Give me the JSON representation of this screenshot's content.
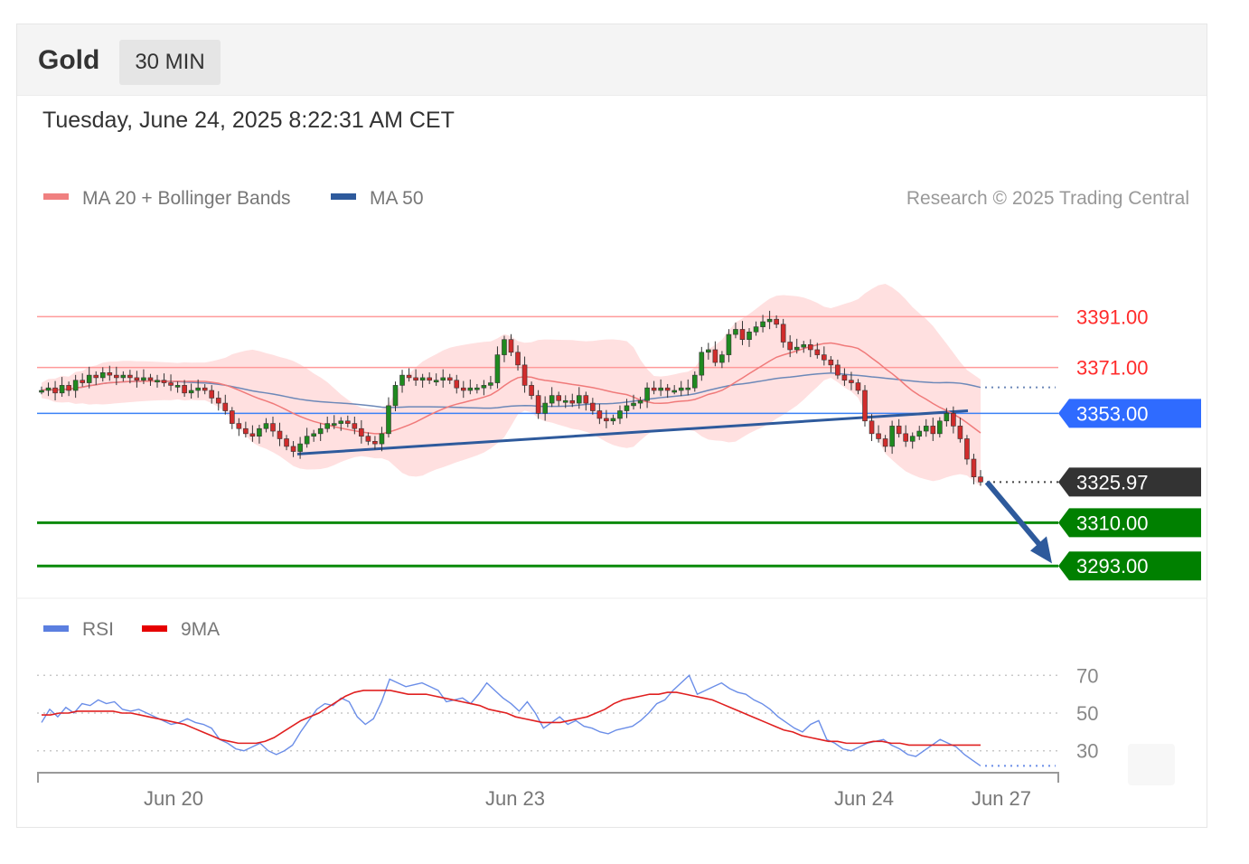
{
  "header": {
    "title": "Gold",
    "timeframe": "30 MIN"
  },
  "timestamp": "Tuesday, June 24, 2025 8:22:31 AM CET",
  "legend": {
    "ma20": {
      "label": "MA 20 + Bollinger Bands",
      "color": "#f08080"
    },
    "ma50": {
      "label": "MA 50",
      "color": "#2e5a9c"
    },
    "rsi": {
      "label": "RSI",
      "color": "#5b7fe0"
    },
    "rsi_ma": {
      "label": "9MA",
      "color": "#e60000"
    }
  },
  "copyright": "Research © 2025 Trading Central",
  "levels": [
    {
      "value": 3391.0,
      "label": "3391.00",
      "kind": "resistance",
      "color": "#ff6b6b"
    },
    {
      "value": 3371.0,
      "label": "3371.00",
      "kind": "resistance",
      "color": "#ff6b6b"
    },
    {
      "value": 3353.0,
      "label": "3353.00",
      "kind": "pivot",
      "color": "#2979ff"
    },
    {
      "value": 3325.97,
      "label": "3325.97",
      "kind": "last",
      "color": "#333333"
    },
    {
      "value": 3310.0,
      "label": "3310.00",
      "kind": "support",
      "color": "#008000"
    },
    {
      "value": 3293.0,
      "label": "3293.00",
      "kind": "support",
      "color": "#008000"
    }
  ],
  "chart_data": [
    {
      "type": "candlestick",
      "title": "Gold",
      "interval": "30 MIN",
      "price_range": [
        3281,
        3416
      ],
      "closes": [
        3362,
        3363,
        3361,
        3364,
        3362,
        3366,
        3365,
        3368,
        3367,
        3369,
        3368,
        3367,
        3368,
        3367,
        3366,
        3367,
        3366,
        3366,
        3365,
        3364,
        3364,
        3361,
        3362,
        3363,
        3362,
        3359,
        3357,
        3354,
        3349,
        3347,
        3345,
        3344,
        3347,
        3349,
        3346,
        3343,
        3340,
        3338,
        3341,
        3344,
        3345,
        3347,
        3349,
        3349,
        3350,
        3349,
        3347,
        3344,
        3342,
        3341,
        3345,
        3356,
        3364,
        3368,
        3367,
        3366,
        3367,
        3366,
        3366,
        3367,
        3366,
        3363,
        3362,
        3363,
        3363,
        3364,
        3365,
        3376,
        3382,
        3377,
        3372,
        3364,
        3360,
        3353,
        3357,
        3360,
        3358,
        3358,
        3357,
        3360,
        3357,
        3354,
        3351,
        3350,
        3351,
        3354,
        3356,
        3357,
        3358,
        3363,
        3362,
        3363,
        3362,
        3362,
        3363,
        3363,
        3368,
        3377,
        3378,
        3373,
        3376,
        3384,
        3386,
        3382,
        3385,
        3387,
        3389,
        3390,
        3388,
        3381,
        3378,
        3379,
        3380,
        3378,
        3376,
        3374,
        3372,
        3368,
        3366,
        3365,
        3362,
        3350,
        3345,
        3343,
        3340,
        3348,
        3345,
        3342,
        3344,
        3346,
        3348,
        3345,
        3350,
        3353,
        3348,
        3343,
        3335,
        3328,
        3326
      ],
      "moving_averages": [
        {
          "name": "MA 20",
          "values_note": "follows closes"
        },
        {
          "name": "MA 50",
          "values_note": "follows closes"
        }
      ],
      "levels": [
        3391.0,
        3371.0,
        3353.0,
        3325.97,
        3310.0,
        3293.0
      ],
      "x_tick_labels": [
        "Jun 20",
        "Jun 23",
        "Jun 24",
        "Jun 27"
      ]
    },
    {
      "type": "line",
      "series": [
        {
          "name": "RSI",
          "values": [
            45,
            52,
            48,
            53,
            50,
            55,
            54,
            57,
            55,
            56,
            52,
            51,
            52,
            50,
            48,
            46,
            44,
            45,
            47,
            45,
            44,
            42,
            36,
            34,
            31,
            30,
            32,
            34,
            30,
            28,
            30,
            33,
            40,
            46,
            52,
            55,
            54,
            58,
            56,
            48,
            44,
            47,
            56,
            68,
            66,
            64,
            65,
            66,
            64,
            62,
            56,
            57,
            58,
            55,
            60,
            66,
            62,
            58,
            55,
            51,
            56,
            50,
            42,
            45,
            48,
            44,
            46,
            43,
            42,
            40,
            39,
            41,
            42,
            43,
            46,
            50,
            55,
            57,
            62,
            66,
            70,
            60,
            62,
            64,
            66,
            63,
            61,
            60,
            57,
            55,
            52,
            48,
            45,
            42,
            40,
            44,
            46,
            36,
            34,
            31,
            30,
            32,
            34,
            35,
            36,
            33,
            31,
            28,
            27,
            30,
            33,
            36,
            34,
            32,
            28,
            25,
            22
          ]
        },
        {
          "name": "9MA",
          "values": [
            49,
            49,
            50,
            50,
            51,
            51,
            51,
            51,
            51,
            50,
            50,
            49,
            48,
            47,
            46,
            45,
            44,
            42,
            40,
            38,
            36,
            35,
            34,
            34,
            34,
            35,
            37,
            40,
            43,
            46,
            48,
            50,
            53,
            56,
            59,
            61,
            62,
            62,
            62,
            62,
            61,
            60,
            60,
            60,
            59,
            58,
            57,
            56,
            55,
            54,
            52,
            51,
            50,
            48,
            47,
            46,
            45,
            45,
            45,
            46,
            47,
            48,
            50,
            52,
            55,
            57,
            58,
            59,
            60,
            60,
            61,
            61,
            60,
            59,
            58,
            57,
            55,
            53,
            51,
            49,
            47,
            45,
            43,
            41,
            40,
            38,
            37,
            36,
            35,
            35,
            34,
            34,
            34,
            35,
            35,
            34,
            34,
            33,
            33,
            33,
            33,
            33,
            33,
            33,
            33,
            33
          ]
        }
      ],
      "y_ticks": [
        30,
        50,
        70
      ],
      "ylim": [
        15,
        85
      ]
    }
  ]
}
